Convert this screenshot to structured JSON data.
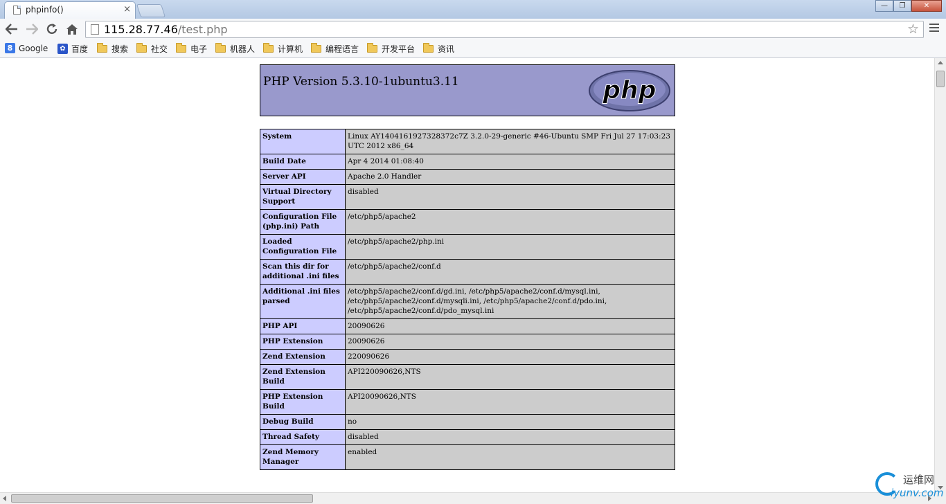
{
  "browser": {
    "tab_title": "phpinfo()",
    "tab_close": "×",
    "url_host": "115.28.77.46",
    "url_path": "/test.php",
    "window_min": "—",
    "window_max": "❐",
    "window_close": "✕"
  },
  "bookmarks": [
    {
      "label": "Google",
      "icon": "google-icon"
    },
    {
      "label": "百度",
      "icon": "baidu-icon"
    },
    {
      "label": "搜索",
      "icon": "folder-icon"
    },
    {
      "label": "社交",
      "icon": "folder-icon"
    },
    {
      "label": "电子",
      "icon": "folder-icon"
    },
    {
      "label": "机器人",
      "icon": "folder-icon"
    },
    {
      "label": "计算机",
      "icon": "folder-icon"
    },
    {
      "label": "编程语言",
      "icon": "folder-icon"
    },
    {
      "label": "开发平台",
      "icon": "folder-icon"
    },
    {
      "label": "资讯",
      "icon": "folder-icon"
    }
  ],
  "page": {
    "header_title": "PHP Version 5.3.10-1ubuntu3.11",
    "logo_text": "php",
    "rows": [
      {
        "key": "System",
        "value": "Linux AY14041619273283​72c7Z 3.2.0-29-generic #46-Ubuntu SMP Fri Jul 27 17:03:23 UTC 2012 x86_64"
      },
      {
        "key": "Build Date",
        "value": "Apr 4 2014 01:08:40"
      },
      {
        "key": "Server API",
        "value": "Apache 2.0 Handler"
      },
      {
        "key": "Virtual Directory Support",
        "value": "disabled"
      },
      {
        "key": "Configuration File (php.ini) Path",
        "value": "/etc/php5/apache2"
      },
      {
        "key": "Loaded Configuration File",
        "value": "/etc/php5/apache2/php.ini"
      },
      {
        "key": "Scan this dir for additional .ini files",
        "value": "/etc/php5/apache2/conf.d"
      },
      {
        "key": "Additional .ini files parsed",
        "value": "/etc/php5/apache2/conf.d/gd.ini, /etc/php5/apache2/conf.d/mysql.ini, /etc/php5/apache2/conf.d/mysqli.ini, /etc/php5/apache2/conf.d/pdo.ini, /etc/php5/apache2/conf.d/pdo_mysql.ini"
      },
      {
        "key": "PHP API",
        "value": "20090626"
      },
      {
        "key": "PHP Extension",
        "value": "20090626"
      },
      {
        "key": "Zend Extension",
        "value": "220090626"
      },
      {
        "key": "Zend Extension Build",
        "value": "API220090626,NTS"
      },
      {
        "key": "PHP Extension Build",
        "value": "API20090626,NTS"
      },
      {
        "key": "Debug Build",
        "value": "no"
      },
      {
        "key": "Thread Safety",
        "value": "disabled"
      },
      {
        "key": "Zend Memory Manager",
        "value": "enabled"
      }
    ]
  },
  "watermark": {
    "cn": "运维网",
    "en": "iyunv.com"
  }
}
